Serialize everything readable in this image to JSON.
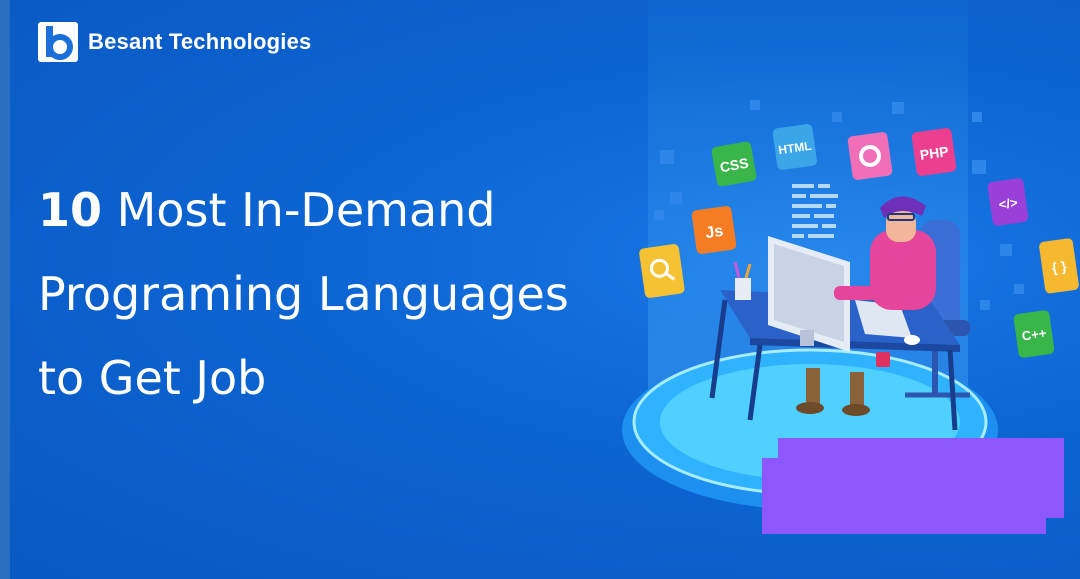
{
  "brand": {
    "name": "Besant Technologies"
  },
  "headline": {
    "number": "10",
    "line1_rest": "Most In-Demand",
    "line2": "Programing Languages",
    "line3": "to Get Job"
  },
  "badges": {
    "css": "CSS",
    "html": "HTML",
    "php": "PHP",
    "js": "Js",
    "code": "</>",
    "braces": "{ }",
    "cpp": "C++"
  },
  "colors": {
    "background": "#0c62cf",
    "overlay": "#8e57fb",
    "css_badge": "#3ab54a",
    "html_badge": "#3aa6e8",
    "php_badge": "#ec3f8f",
    "js_badge": "#f57c22",
    "code_badge": "#9b3fd9",
    "braces_badge": "#f5b82e",
    "cpp_badge": "#3ab54a",
    "search_badge": "#f5c233",
    "gear_badge": "#f06fb8"
  },
  "icons": [
    "logo-b-icon",
    "search-icon",
    "gear-icon",
    "monitor-icon",
    "keyboard-icon",
    "mouse-icon",
    "chair-icon",
    "pen-cup-icon",
    "mug-icon"
  ]
}
